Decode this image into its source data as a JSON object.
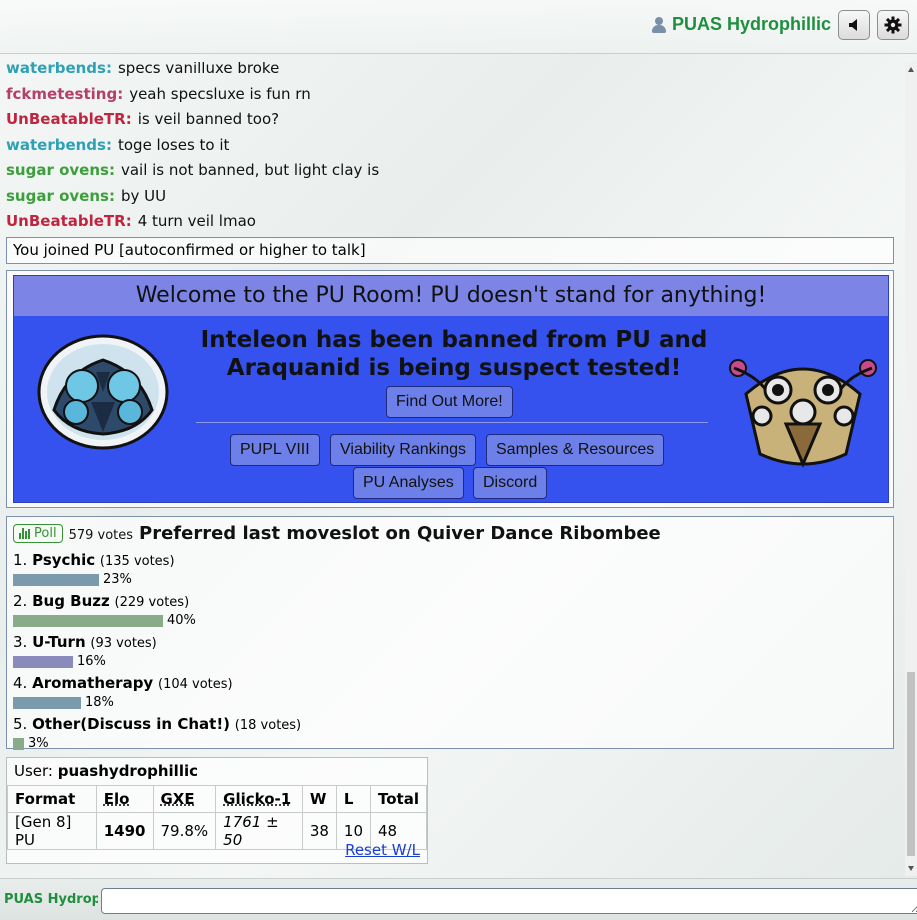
{
  "header": {
    "username": "PUAS Hydrophillic",
    "sound_icon": "volume-icon",
    "gear_icon": "gear-icon"
  },
  "chat": [
    {
      "author": "waterbends:",
      "color": "#2fa1b5",
      "message": "specs vanilluxe broke"
    },
    {
      "author": "fckmetesting:",
      "color": "#b3406a",
      "message": "yeah specsluxe is fun rn"
    },
    {
      "author": "UnBeatableTR:",
      "color": "#c0243e",
      "message": "is veil banned too?"
    },
    {
      "author": "waterbends:",
      "color": "#2fa1b5",
      "message": "toge loses to it"
    },
    {
      "author": "sugar ovens:",
      "color": "#3c9f3c",
      "message": "vail is not banned, but light clay is"
    },
    {
      "author": "sugar ovens:",
      "color": "#3c9f3c",
      "message": "by UU"
    },
    {
      "author": "UnBeatableTR:",
      "color": "#c0243e",
      "message": "4 turn veil lmao"
    }
  ],
  "notice": "You joined PU [autoconfirmed or higher to talk]",
  "banner": {
    "welcome": "Welcome to the PU Room! PU doesn't stand for anything!",
    "headline": "Inteleon has been banned from PU and Araquanid is being suspect tested!",
    "find_out": "Find Out More!",
    "links": [
      "PUPL VIII",
      "Viability Rankings",
      "Samples & Resources",
      "PU Analyses",
      "Discord"
    ]
  },
  "poll": {
    "badge": "Poll",
    "votes": "579 votes",
    "question": "Preferred last moveslot on Quiver Dance Ribombee",
    "options": [
      {
        "num": "1.",
        "name": "Psychic",
        "count": "(135 votes)",
        "pct": "23%",
        "fraction": 0.23,
        "color": "#7b9bad"
      },
      {
        "num": "2.",
        "name": "Bug Buzz",
        "count": "(229 votes)",
        "pct": "40%",
        "fraction": 0.4,
        "color": "#8aab8a"
      },
      {
        "num": "3.",
        "name": "U-Turn",
        "count": "(93 votes)",
        "pct": "16%",
        "fraction": 0.16,
        "color": "#8a8abb"
      },
      {
        "num": "4.",
        "name": "Aromatherapy",
        "count": "(104 votes)",
        "pct": "18%",
        "fraction": 0.18,
        "color": "#7b9bad"
      },
      {
        "num": "5.",
        "name": "Other(Discuss in Chat!)",
        "count": "(18 votes)",
        "pct": "3%",
        "fraction": 0.03,
        "color": "#8aab8a"
      }
    ]
  },
  "ladder": {
    "user_label": "User:",
    "user": "puashydrophillic",
    "headers": [
      "Format",
      "Elo",
      "GXE",
      "Glicko-1",
      "W",
      "L",
      "Total"
    ],
    "row": {
      "format": "[Gen 8] PU",
      "elo": "1490",
      "gxe": "79.8%",
      "glicko": "1761 ± 50",
      "w": "38",
      "l": "10",
      "total": "48"
    },
    "reset": "Reset W/L"
  },
  "bottom": {
    "name": "PUAS Hydrophillic",
    "input_value": ""
  }
}
